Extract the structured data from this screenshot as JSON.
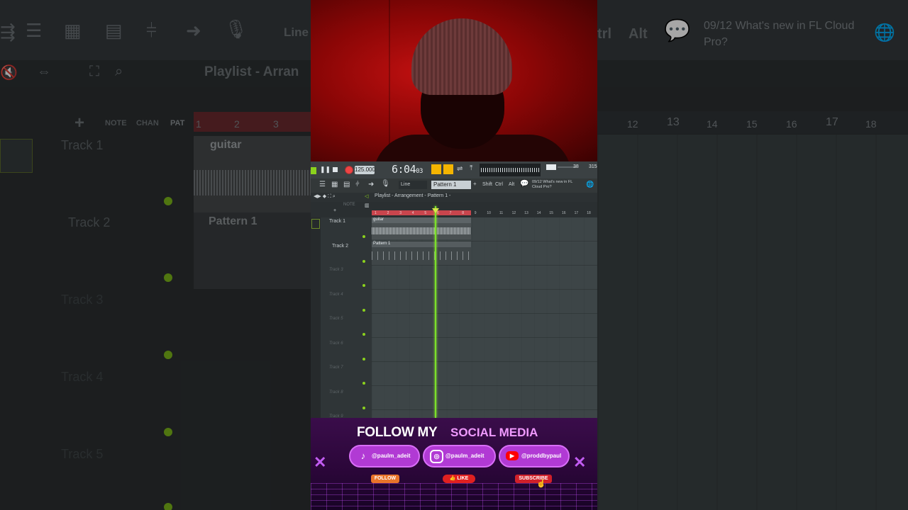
{
  "background": {
    "notification": "09/12  What's new in FL Cloud Pro?",
    "playlist_title": "Playlist - Arran",
    "line_label": "Line",
    "key_ctrl": "trl",
    "key_alt": "Alt",
    "note_label": "NOTE",
    "chan_label": "CHAN",
    "pat_label": "PAT",
    "track_names": [
      "Track 1",
      "Track 2",
      "Track 3",
      "Track 4",
      "Track 5"
    ],
    "clip_guitar": "guitar",
    "clip_pattern": "Pattern 1",
    "ruler_left": [
      "1",
      "2",
      "3"
    ],
    "ruler_right": [
      "12",
      "13",
      "14",
      "15",
      "16",
      "17",
      "18"
    ]
  },
  "daw": {
    "time": "6:04",
    "time_frac": "03",
    "tempo": "125.000",
    "pattern_selector": "Pattern 1",
    "snap": "Line",
    "keys": [
      "Shift",
      "Ctrl",
      "Alt"
    ],
    "notification": "09/12  What's new in FL Cloud Pro?",
    "cpu_values": [
      "38",
      "315"
    ],
    "playlist_title": "Playlist - Arrangement - Pattern 1 -",
    "tracks": [
      {
        "name": "Track 1",
        "active": true
      },
      {
        "name": "Track 2",
        "active": true
      },
      {
        "name": "Track 3",
        "active": false
      },
      {
        "name": "Track 4",
        "active": false
      },
      {
        "name": "Track 5",
        "active": false
      },
      {
        "name": "Track 6",
        "active": false
      },
      {
        "name": "Track 7",
        "active": false
      },
      {
        "name": "Track 8",
        "active": false
      },
      {
        "name": "Track 9",
        "active": false
      }
    ],
    "clips": {
      "guitar": "guitar",
      "pattern": "Pattern 1"
    },
    "ruler_numbers": [
      "1",
      "2",
      "3",
      "4",
      "5",
      "6",
      "7",
      "8",
      "9",
      "10",
      "11",
      "12",
      "13",
      "14",
      "15",
      "16",
      "17",
      "18"
    ]
  },
  "promo": {
    "follow_my": "FOLLOW MY",
    "social_media": "SOCIAL MEDIA",
    "tiktok_handle": "@paulm_adeit",
    "instagram_handle": "@paulm_adeit",
    "youtube_handle": "@proddbypaul",
    "follow_btn": "FOLLOW",
    "like_btn": "LIKE",
    "subscribe_btn": "SUBSCRIBE",
    "colors": {
      "accent": "#b13ad4",
      "title": "#f09aff",
      "follow": "#e8742a",
      "like": "#e02020",
      "subscribe": "#d0202a"
    }
  }
}
